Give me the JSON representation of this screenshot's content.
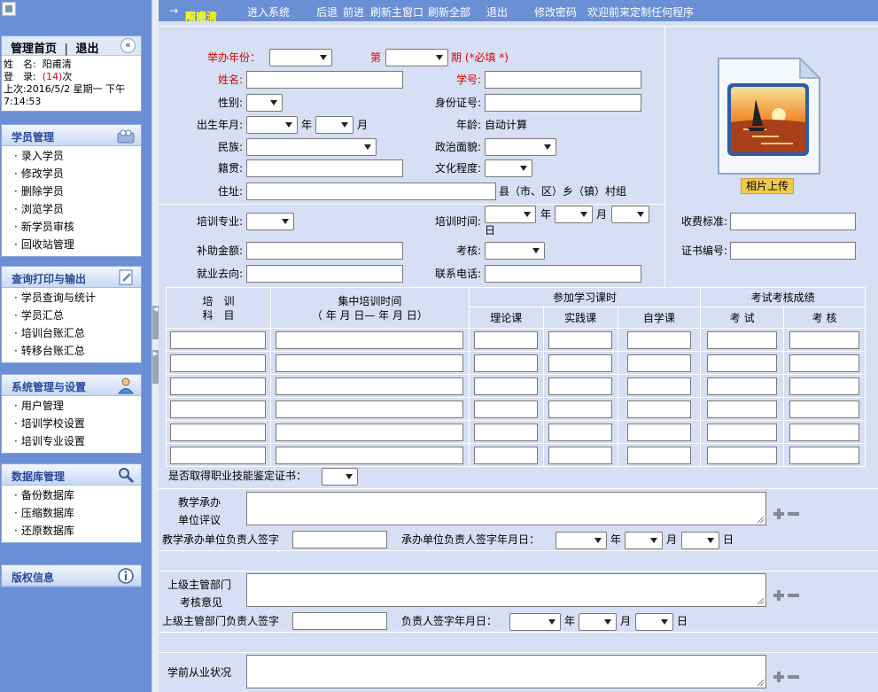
{
  "topbar": {
    "arrow": "→",
    "welcome_prefix": "欢迎",
    "username": "阳甫清",
    "enter_system": "进入系统",
    "back": "后退",
    "forward": "前进",
    "refresh_main": "刷新主窗口",
    "refresh_all": "刷新全部",
    "logout": "退出",
    "change_password": "修改密码",
    "welcome_custom": "欢迎前来定制任何程序"
  },
  "user_box": {
    "home": "管理首页",
    "separator": "|",
    "exit": "退出",
    "collapse": "«",
    "name_label": "姓　名:",
    "name": "阳甫清",
    "login_label": "登　录:",
    "login_count": "(14)",
    "login_suffix": "次",
    "last_label": "上次:",
    "last_time": "2016/5/2 星期一 下午 7:14:53"
  },
  "menus": [
    {
      "title": "学员管理",
      "icon": "people-icon",
      "items": [
        "录入学员",
        "修改学员",
        "删除学员",
        "浏览学员",
        "新学员审核",
        "回收站管理"
      ]
    },
    {
      "title": "查询打印与输出",
      "icon": "edit-document-icon",
      "items": [
        "学员查询与统计",
        "学员汇总",
        "培训台账汇总",
        "转移台账汇总"
      ]
    },
    {
      "title": "系统管理与设置",
      "icon": "user-settings-icon",
      "items": [
        "用户管理",
        "培训学校设置",
        "培训专业设置"
      ]
    },
    {
      "title": "数据库管理",
      "icon": "magnifier-icon",
      "items": [
        "备份数据库",
        "压缩数据库",
        "还原数据库"
      ]
    },
    {
      "title": "版权信息",
      "icon": "info-icon",
      "items": []
    }
  ],
  "form": {
    "year_label": "举办年份：",
    "period_prefix": "第",
    "period_suffix": "期 (*必填 *)",
    "name_label": "姓名:",
    "student_no_label": "学号:",
    "gender_label": "性别:",
    "id_label": "身份证号:",
    "birth_label": "出生年月:",
    "year_unit": "年",
    "month_unit": "月",
    "day_unit": "日",
    "age_label": "年龄:",
    "age_value": "自动计算",
    "ethnic_label": "民族:",
    "political_label": "政治面貌:",
    "native_label": "籍贯:",
    "education_label": "文化程度:",
    "address_label": "住址:",
    "address_suffix": "县（市、区）乡（镇）村组",
    "major_label": "培训专业:",
    "train_time_label": "培训时间:",
    "fee_label": "收费标准:",
    "subsidy_label": "补助金额:",
    "exam_label": "考核:",
    "cert_no_label": "证书编号:",
    "employment_label": "就业去向:",
    "phone_label": "联系电话:",
    "photo_button": "相片上传",
    "cert_question": "是否取得职业技能鉴定证书：",
    "school_eval_label_1": "教学承办",
    "school_eval_label_2": "单位评议",
    "school_sign_label": "教学承办单位负责人签字",
    "school_date_label": "承办单位负责人签字年月日：",
    "dept_eval_label_1": "上级主管部门",
    "dept_eval_label_2": "考核意见",
    "dept_sign_label": "上级主管部门负责人签字",
    "dept_date_label": "负责人签字年月日：",
    "prior_job_label": "学前从业状况"
  },
  "course_table": {
    "col_subject_1": "培　训",
    "col_subject_2": "科　目",
    "col_time_1": "集中培训时间",
    "col_time_2": "（ 年 月 日— 年 月 日）",
    "group_hours": "参加学习课时",
    "group_scores": "考试考核成绩",
    "theory": "理论课",
    "practice": "实践课",
    "self": "自学课",
    "exam": "考 试",
    "assess": "考 核",
    "row_count": 6
  }
}
